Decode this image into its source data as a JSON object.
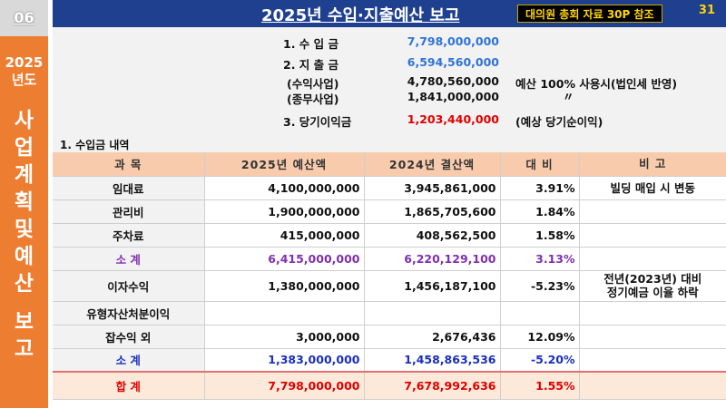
{
  "section_number": "06",
  "sidebar": {
    "year": [
      "2025",
      "년도"
    ],
    "title_lines": [
      "사",
      "업",
      "계",
      "획",
      "및",
      "예",
      "산",
      "",
      "보",
      "고"
    ]
  },
  "header": {
    "title": "2025년 수입·지출예산 보고",
    "reference": "대의원 총회 자료 30P 참조",
    "page_number": "31"
  },
  "summary": [
    {
      "label": "1. 수 입 금",
      "value": "7,798,000,000",
      "note": ""
    },
    {
      "label": "2. 지 출 금",
      "value": "6,594,560,000",
      "note": ""
    },
    {
      "label": "(수익사업)",
      "value": "4,780,560,000",
      "note": "예산 100% 사용시(법인세 반영)"
    },
    {
      "label": "(종무사업)",
      "value": "1,841,000,000",
      "note": "〃"
    },
    {
      "label": "3. 당기이익금",
      "value": "1,203,440,000",
      "note": "(예상 당기순이익)"
    }
  ],
  "section_title": "1. 수입금 내역",
  "table": {
    "headers": [
      "과   목",
      "2025년 예산액",
      "2024년 결산액",
      "대 비",
      "비 고"
    ],
    "rows": [
      [
        "임대료",
        "4,100,000,000",
        "3,945,861,000",
        "3.91%",
        "빌딩 매입 시 변동"
      ],
      [
        "관리비",
        "1,900,000,000",
        "1,865,705,600",
        "1.84%",
        ""
      ],
      [
        "주차료",
        "415,000,000",
        "408,562,500",
        "1.58%",
        ""
      ],
      [
        "소   계",
        "6,415,000,000",
        "6,220,129,100",
        "3.13%",
        ""
      ],
      [
        "이자수익",
        "1,380,000,000",
        "1,456,187,100",
        "-5.23%",
        "전년(2023년) 대비\n정기예금 이율 하락"
      ],
      [
        "유형자산처분이익",
        "",
        "",
        "",
        ""
      ],
      [
        "잡수익 외",
        "3,000,000",
        "2,676,436",
        "12.09%",
        ""
      ],
      [
        "소  계",
        "1,383,000,000",
        "1,458,863,536",
        "-5.20%",
        ""
      ],
      [
        "합  계",
        "7,798,000,000",
        "7,678,992,636",
        "1.55%",
        ""
      ]
    ]
  },
  "colors": {
    "header_bg": "#1f3f8f",
    "sidebar_orange": "#ed7d31",
    "table_header_bg": "#f8cbad",
    "value_blue": "#2e74d6",
    "value_red": "#e00000",
    "subtotal_purple": "#8030b0",
    "subtotal_blue": "#1a2fbf"
  }
}
